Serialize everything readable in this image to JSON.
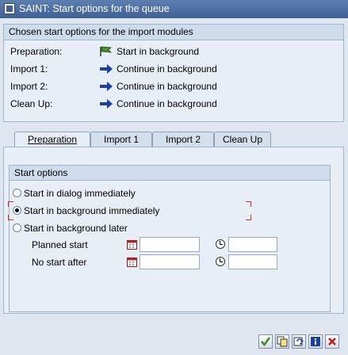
{
  "window": {
    "title": "SAINT: Start options for the queue"
  },
  "chosen": {
    "title": "Chosen start options for the import modules",
    "rows": [
      {
        "label": "Preparation:",
        "value": "Start in background",
        "icon": "flag-icon"
      },
      {
        "label": "Import 1:",
        "value": "Continue in background",
        "icon": "arrow-right-icon"
      },
      {
        "label": "Import 2:",
        "value": "Continue in background",
        "icon": "arrow-right-icon"
      },
      {
        "label": "Clean Up:",
        "value": "Continue in background",
        "icon": "arrow-right-icon"
      }
    ]
  },
  "tabs": [
    {
      "label": "Preparation",
      "active": true
    },
    {
      "label": "Import 1",
      "active": false
    },
    {
      "label": "Import 2",
      "active": false
    },
    {
      "label": "Clean Up",
      "active": false
    }
  ],
  "start_options": {
    "title": "Start options",
    "radios": [
      {
        "label": "Start in dialog immediately",
        "checked": false
      },
      {
        "label": "Start in background immediately",
        "checked": true
      },
      {
        "label": "Start in background later",
        "checked": false
      }
    ],
    "planned_start": {
      "label": "Planned start",
      "date": "",
      "time": ""
    },
    "no_start_after": {
      "label": "No start after",
      "date": "",
      "time": ""
    }
  },
  "footer_buttons": [
    "confirm-icon",
    "copy-icon",
    "refresh-icon",
    "info-icon",
    "cancel-icon"
  ],
  "colors": {
    "title_bar": "#3e6096",
    "focus_marker": "#d43030",
    "arrow": "#1a3fa8"
  }
}
